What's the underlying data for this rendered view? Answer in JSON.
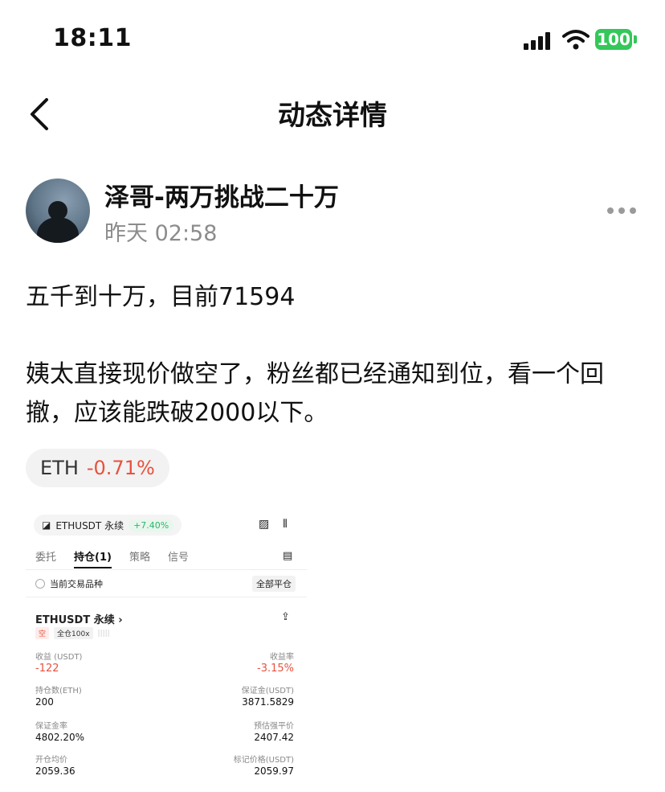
{
  "status_bar": {
    "time": "18:11",
    "battery": "100"
  },
  "header": {
    "title": "动态详情"
  },
  "author": {
    "name": "泽哥-两万挑战二十万",
    "time": "昨天 02:58"
  },
  "post": {
    "line1": "五千到十万，目前71594",
    "paragraph": "姨太直接现价做空了，粉丝都已经通知到位，看一个回撤，应该能跌破2000以下。"
  },
  "tag": {
    "symbol": "ETH",
    "change": "-0.71%"
  },
  "shot": {
    "pair": "ETHUSDT 永续",
    "pair_change": "+7.40%",
    "tabs": [
      "委托",
      "持仓(1)",
      "策略",
      "信号"
    ],
    "current_label": "当前交易品种",
    "close_all": "全部平仓",
    "position_title": "ETHUSDT 永续",
    "side": "空",
    "margin_mode": "全仓100x",
    "fields": {
      "pnl_label": "收益 (USDT)",
      "pnl": "-122",
      "pnl_rate_label": "收益率",
      "pnl_rate": "-3.15%",
      "qty_label": "持仓数(ETH)",
      "qty": "200",
      "margin_label": "保证金(USDT)",
      "margin": "3871.5829",
      "margin_rate_label": "保证金率",
      "margin_rate": "4802.20%",
      "liq_label": "预估强平价",
      "liq": "2407.42",
      "entry_label": "开仓均价",
      "entry": "2059.36",
      "mark_label": "标记价格(USDT)",
      "mark": "2059.97"
    }
  }
}
